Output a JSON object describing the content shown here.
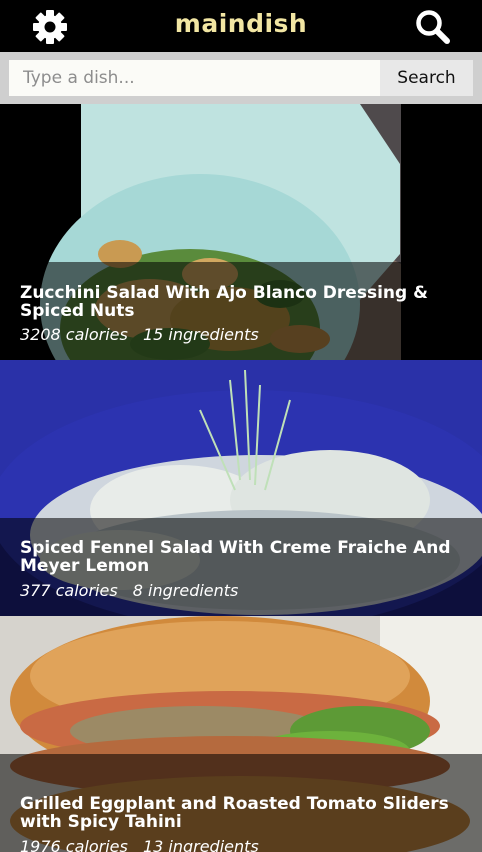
{
  "app": {
    "title": "maindish",
    "settings_icon": "gear-icon",
    "search_icon": "search-icon"
  },
  "search": {
    "placeholder": "Type a dish...",
    "value": "",
    "button_label": "Search"
  },
  "recipes": [
    {
      "title": "Zucchini Salad With Ajo Blanco Dressing & Spiced Nuts",
      "calories": "3208 calories",
      "ingredients": "15 ingredients"
    },
    {
      "title": "Spiced Fennel Salad With Creme Fraiche And Meyer Lemon",
      "calories": "377 calories",
      "ingredients": "8 ingredients"
    },
    {
      "title": "Grilled Eggplant and Roasted Tomato Sliders with Spicy Tahini",
      "calories": "1976 calories",
      "ingredients": "13 ingredients"
    }
  ],
  "colors": {
    "title_accent": "#f2e6a3",
    "topbar": "#000000",
    "searchbar": "#cfcfcf"
  }
}
